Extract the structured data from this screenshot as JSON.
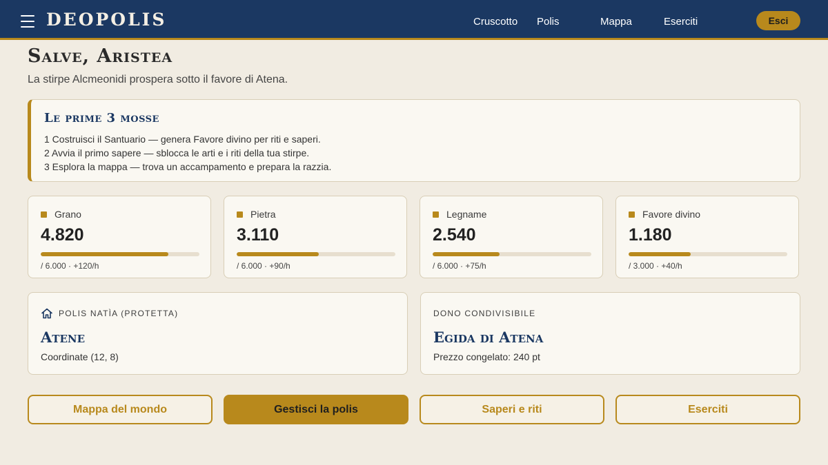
{
  "header": {
    "brand": "DEOPOLIS",
    "nav": [
      "Cruscotto",
      "Polis",
      "Mappa",
      "Eserciti"
    ],
    "logout_label": "Esci"
  },
  "greeting": {
    "title": "Salve, Aristea",
    "subtitle": "La stirpe Alcmeonidi prospera sotto il favore di Atena."
  },
  "tips": {
    "title": "Le prime 3 mosse",
    "steps": [
      "1 Costruisci il Santuario — genera Favore divino per riti e saperi.",
      "2 Avvia il primo sapere — sblocca le arti e i riti della tua stirpe.",
      "3 Esplora la mappa — trova un accampamento e prepara la razzia."
    ]
  },
  "resources": [
    {
      "name": "Grano",
      "value": "4.820",
      "meta": "/ 6.000 · +120/h",
      "fraction": 0.803
    },
    {
      "name": "Pietra",
      "value": "3.110",
      "meta": "/ 6.000 · +90/h",
      "fraction": 0.518
    },
    {
      "name": "Legname",
      "value": "2.540",
      "meta": "/ 6.000 · +75/h",
      "fraction": 0.423
    },
    {
      "name": "Favore divino",
      "value": "1.180",
      "meta": "/ 3.000 · +40/h",
      "fraction": 0.393
    }
  ],
  "polis_card": {
    "caption": "POLIS NATÌA (PROTETTA)",
    "title": "Atene",
    "detail": "Coordinate (12, 8)",
    "icon": "home-icon"
  },
  "gift_card": {
    "caption": "DONO CONDIVISIBILE",
    "title": "Egida di Atena",
    "detail": "Prezzo congelato: 240 pt"
  },
  "actions": [
    "Mappa del mondo",
    "Gestisci la polis",
    "Saperi e riti",
    "Eserciti"
  ],
  "colors": {
    "header_bg": "#1b3862",
    "accent": "#b8891c",
    "page_bg": "#f1ece2",
    "card_bg": "#faf8f2",
    "title_blue": "#1b3862"
  }
}
